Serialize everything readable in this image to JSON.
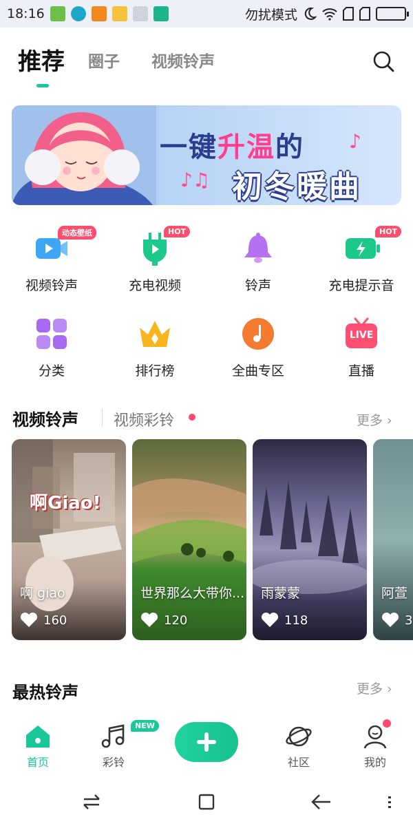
{
  "status_bar": {
    "time": "18:16",
    "mode_text": "勿扰模式"
  },
  "top_tabs": [
    {
      "label": "推荐"
    },
    {
      "label": "圈子"
    },
    {
      "label": "视频铃声"
    }
  ],
  "banner": {
    "line1_a": "一键",
    "line1_b": "升温",
    "line1_c": "的",
    "line2": "初冬暖曲"
  },
  "quick_entries": [
    {
      "label": "视频铃声",
      "badge": "动态壁纸",
      "icon": "video-camera-icon"
    },
    {
      "label": "充电视频",
      "badge": "HOT",
      "icon": "charging-plug-icon"
    },
    {
      "label": "铃声",
      "badge": "",
      "icon": "bell-icon"
    },
    {
      "label": "充电提示音",
      "badge": "HOT",
      "icon": "battery-bolt-icon"
    },
    {
      "label": "分类",
      "badge": "",
      "icon": "category-grid-icon"
    },
    {
      "label": "排行榜",
      "badge": "",
      "icon": "crown-icon"
    },
    {
      "label": "全曲专区",
      "badge": "",
      "icon": "music-note-icon"
    },
    {
      "label": "直播",
      "badge": "LIVE",
      "icon": "live-tv-icon"
    }
  ],
  "video_section": {
    "title": "视频铃声",
    "subtitle": "视频彩铃",
    "more": "更多"
  },
  "video_cards": [
    {
      "title": "啊 giao",
      "overlay": "啊Giao!",
      "likes": "160"
    },
    {
      "title": "世界那么大带你...",
      "likes": "120"
    },
    {
      "title": "雨蒙蒙",
      "likes": "118"
    },
    {
      "title": "阿萱",
      "likes": "3"
    }
  ],
  "hot_section": {
    "title": "最热铃声",
    "more": "更多"
  },
  "bottom_nav": {
    "items": [
      {
        "label": "首页"
      },
      {
        "label": "彩铃"
      },
      {
        "label": "社区"
      },
      {
        "label": "我的"
      }
    ],
    "new_badge": "NEW"
  },
  "colors": {
    "accent": "#19c89a",
    "hot_badge": "#ff4d6d"
  }
}
